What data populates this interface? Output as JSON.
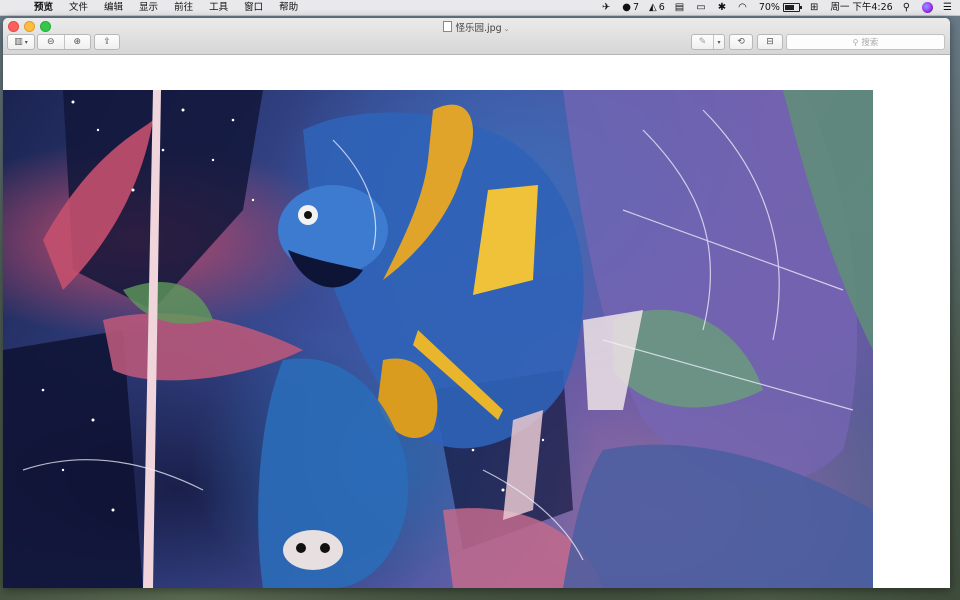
{
  "menubar": {
    "apple_icon": "apple-icon",
    "items": [
      "预览",
      "文件",
      "编辑",
      "显示",
      "前往",
      "工具",
      "窗口",
      "帮助"
    ],
    "status": {
      "notification_count_1": "7",
      "adobe_count": "6",
      "battery_percent": "70%",
      "clock": "周一 下午4:26"
    }
  },
  "window": {
    "title": "怪乐园.jpg",
    "search_placeholder": "搜索"
  },
  "colors": {
    "close": "#fc605c",
    "minimize": "#fdbc40",
    "maximize": "#34c84a"
  }
}
